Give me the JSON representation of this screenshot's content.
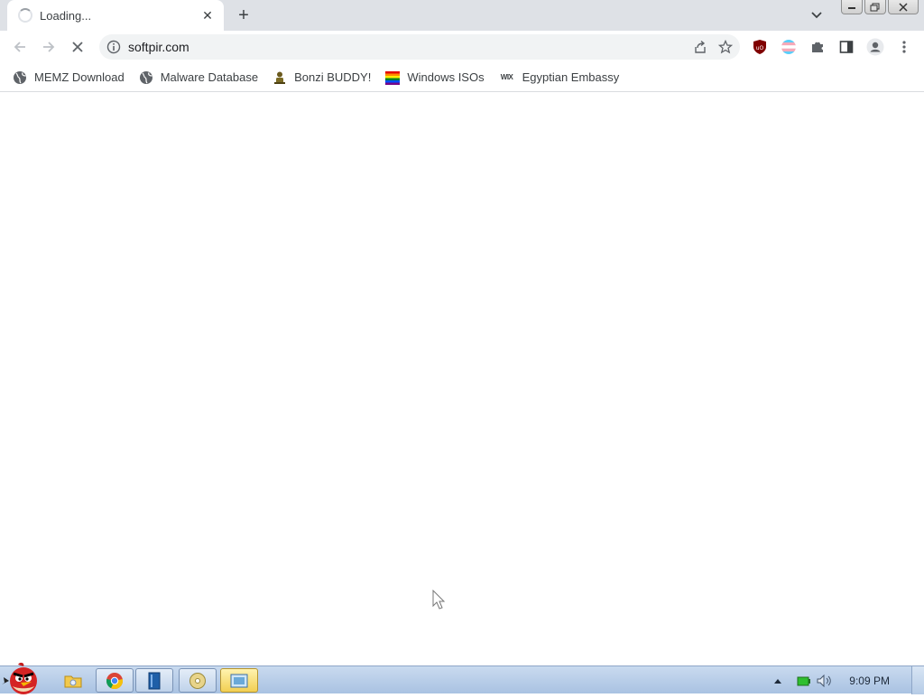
{
  "browser": {
    "tab": {
      "title": "Loading...",
      "close_label": "✕"
    },
    "new_tab_label": "+",
    "address": {
      "url": "softpir.com"
    }
  },
  "bookmarks": [
    {
      "label": "MEMZ Download",
      "icon": "globe-icon"
    },
    {
      "label": "Malware Database",
      "icon": "globe-icon"
    },
    {
      "label": "Bonzi BUDDY!",
      "icon": "bonzi-icon"
    },
    {
      "label": "Windows ISOs",
      "icon": "rainbow-flag-icon"
    },
    {
      "label": "Egyptian Embassy",
      "icon": "wix-icon"
    }
  ],
  "bookmark_wix_text": "WIX",
  "taskbar": {
    "clock": "9:09 PM"
  },
  "colors": {
    "tabstrip": "#dee1e6",
    "omnibox": "#f1f3f4",
    "taskbar": "#b9cfe9",
    "ublock": "#800000"
  }
}
